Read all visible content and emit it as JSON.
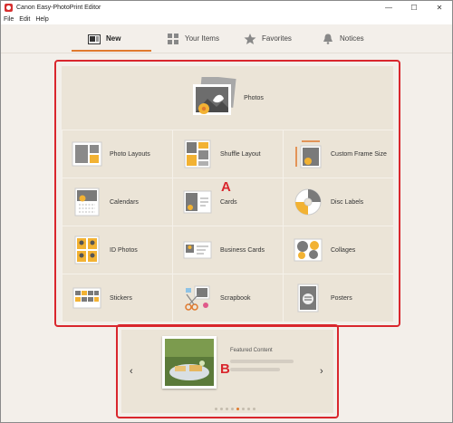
{
  "window": {
    "title": "Canon Easy-PhotoPrint Editor",
    "minimize": "—",
    "maximize": "☐",
    "close": "✕"
  },
  "menu": [
    "File",
    "Edit",
    "Help"
  ],
  "nav": {
    "tabs": [
      {
        "label": "New",
        "icon": "new-icon",
        "active": true
      },
      {
        "label": "Your Items",
        "icon": "grid-icon",
        "active": false
      },
      {
        "label": "Favorites",
        "icon": "star-icon",
        "active": false
      },
      {
        "label": "Notices",
        "icon": "bell-icon",
        "active": false
      }
    ],
    "accent": "#e07a2e"
  },
  "hero": {
    "label": "Photos"
  },
  "tiles": [
    {
      "label": "Photo Layouts",
      "icon": "photo-layouts-icon"
    },
    {
      "label": "Shuffle Layout",
      "icon": "shuffle-layout-icon"
    },
    {
      "label": "Custom Frame Size",
      "icon": "custom-frame-size-icon"
    },
    {
      "label": "Calendars",
      "icon": "calendars-icon"
    },
    {
      "label": "Cards",
      "icon": "cards-icon"
    },
    {
      "label": "Disc Labels",
      "icon": "disc-labels-icon"
    },
    {
      "label": "ID Photos",
      "icon": "id-photos-icon"
    },
    {
      "label": "Business Cards",
      "icon": "business-cards-icon"
    },
    {
      "label": "Collages",
      "icon": "collages-icon"
    },
    {
      "label": "Stickers",
      "icon": "stickers-icon"
    },
    {
      "label": "Scrapbook",
      "icon": "scrapbook-icon"
    },
    {
      "label": "Posters",
      "icon": "posters-icon"
    }
  ],
  "markers": {
    "a": "A",
    "b": "B"
  },
  "featured": {
    "title": "Featured Content",
    "prev": "‹",
    "next": "›",
    "pages": 8,
    "active_page": 4
  },
  "highlight_color": "#d9262d"
}
